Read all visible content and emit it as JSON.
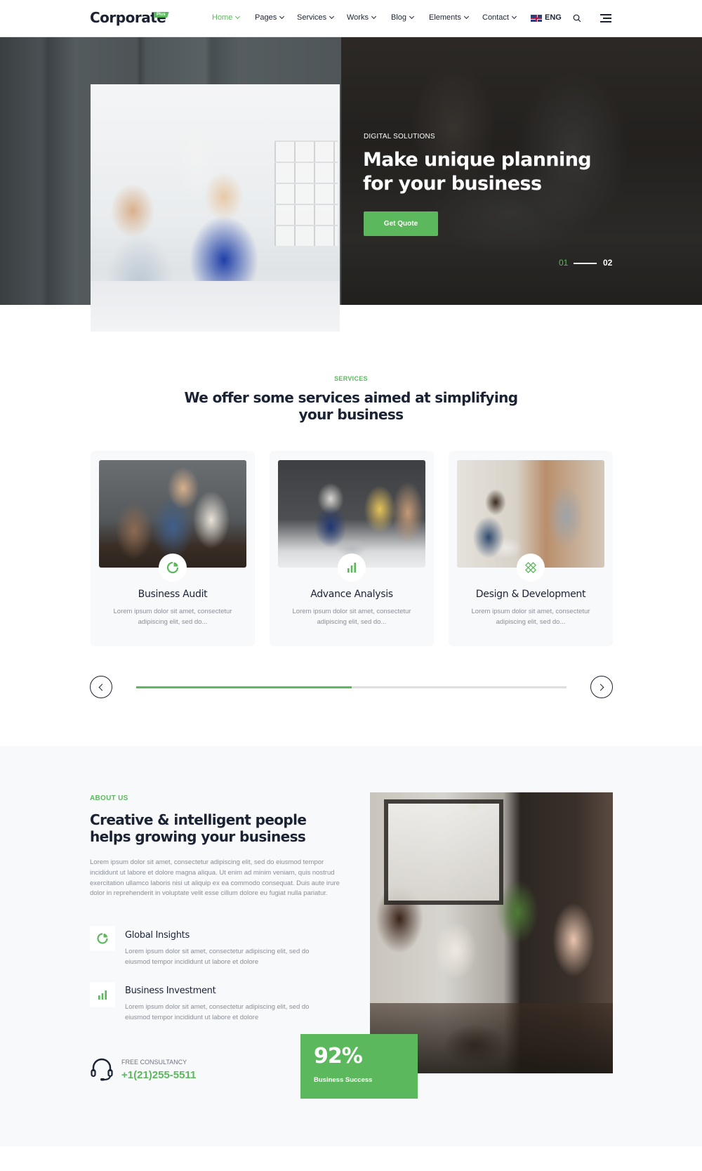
{
  "header": {
    "logo": "Corporate",
    "logo_badge": "Plus",
    "nav": [
      {
        "label": "Home",
        "active": true
      },
      {
        "label": "Pages",
        "active": false
      },
      {
        "label": "Services",
        "active": false
      },
      {
        "label": "Works",
        "active": false
      },
      {
        "label": "Blog",
        "active": false
      },
      {
        "label": "Elements",
        "active": false
      },
      {
        "label": "Contact",
        "active": false
      }
    ],
    "language": "ENG",
    "language_flag": "uk-flag-icon",
    "search_icon": "search-icon",
    "menu_icon": "hamburger-menu-icon"
  },
  "hero": {
    "eyebrow": "DIGITAL SOLUTIONS",
    "title": "Make unique planning for your business",
    "button_label": "Get Quote",
    "slide_current": "01",
    "slide_next": "02"
  },
  "services": {
    "label": "SERVICES",
    "title": "We offer some services aimed at simplifying your business",
    "cards": [
      {
        "title": "Business Audit",
        "description": "Lorem ipsum dolor sit amet, consectetur adipiscing elit, sed do...",
        "icon": "pie-chart-icon"
      },
      {
        "title": "Advance Analysis",
        "description": "Lorem ipsum dolor sit amet, consectetur adipiscing elit, sed do...",
        "icon": "bar-chart-icon"
      },
      {
        "title": "Design & Development",
        "description": "Lorem ipsum dolor sit amet, consectetur adipiscing elit, sed do...",
        "icon": "pencil-ruler-icon"
      }
    ],
    "slider_progress": 0.5
  },
  "about": {
    "label": "ABOUT US",
    "title": "Creative & intelligent people helps growing your business",
    "text": "Lorem ipsum dolor sit amet, consectetur adipiscing elit, sed do eiusmod tempor incididunt ut labore et dolore magna aliqua. Ut enim ad minim veniam, quis nostrud exercitation ullamco laboris nisi ut aliquip ex ea commodo consequat. Duis aute irure dolor in reprehenderit in voluptate velit esse cillum dolore eu fugiat nulla pariatur.",
    "features": [
      {
        "title": "Global Insights",
        "description": "Lorem ipsum dolor sit amet, consectetur adipiscing elit, sed do eiusmod tempor incididunt ut labore et dolore",
        "icon": "pie-chart-icon"
      },
      {
        "title": "Business Investment",
        "description": "Lorem ipsum dolor sit amet, consectetur adipiscing elit, sed do eiusmod tempor incididunt ut labore et dolore",
        "icon": "bar-chart-icon"
      }
    ],
    "consultancy_label": "FREE CONSULTANCY",
    "consultancy_phone": "+1(21)255-5511",
    "stat_value": "92%",
    "stat_label": "Business Success"
  },
  "colors": {
    "accent": "#5cb85c",
    "text_dark": "#1b2233",
    "text_muted": "#8a8f96",
    "section_bg": "#f7f9fb"
  }
}
